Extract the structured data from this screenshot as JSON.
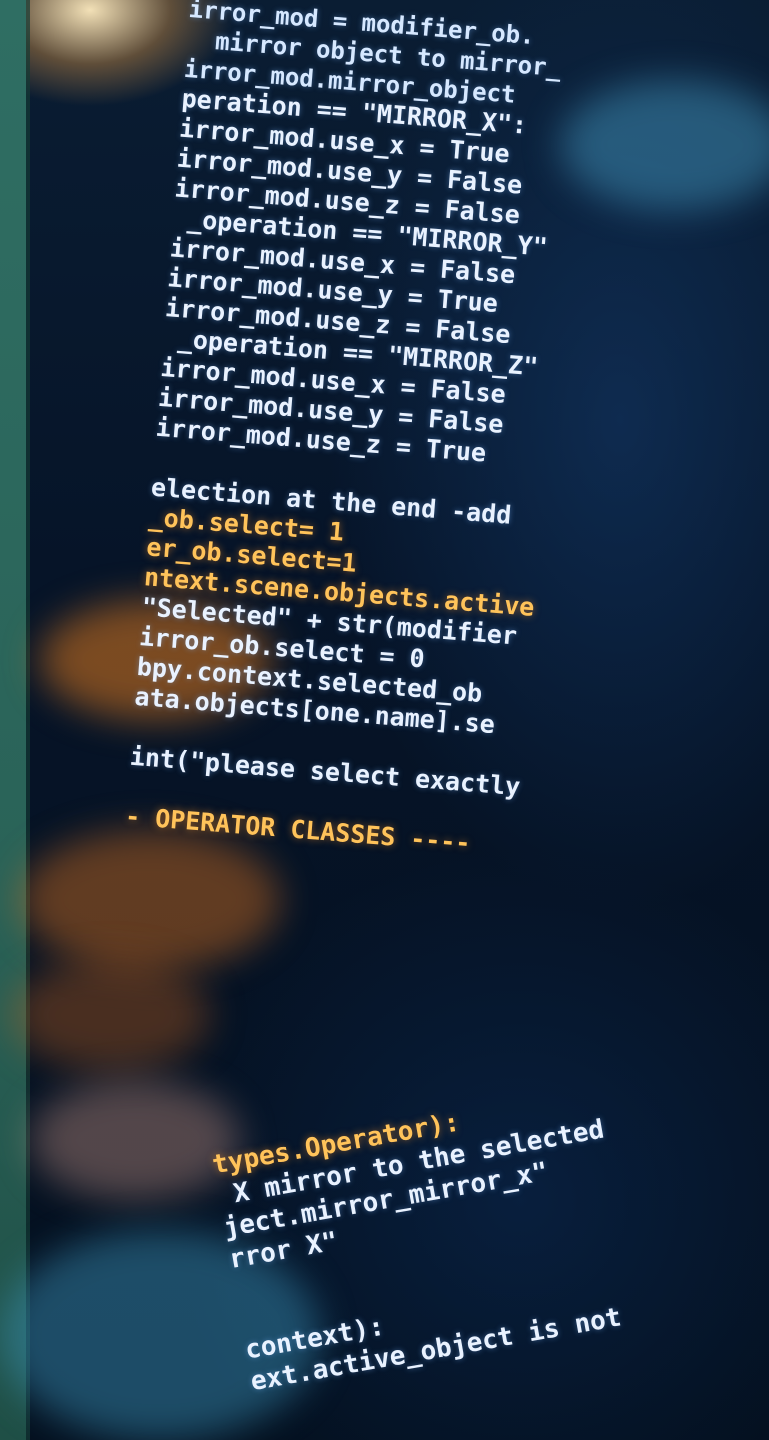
{
  "code_top": [
    "irror_mod = modifier_ob.",
    "  mirror object to mirror_",
    "irror_mod.mirror_object",
    "peration == \"MIRROR_X\":",
    "irror_mod.use_x = True",
    "irror_mod.use_y = False",
    "irror_mod.use_z = False",
    " _operation == \"MIRROR_Y\"",
    "irror_mod.use_x = False",
    "irror_mod.use_y = True",
    "irror_mod.use_z = False",
    " _operation == \"MIRROR_Z\"",
    "irror_mod.use_x = False",
    "irror_mod.use_y = False",
    "irror_mod.use_z = True",
    "",
    "election at the end -add",
    "_ob.select= 1",
    "er_ob.select=1",
    "ntext.scene.objects.active",
    "\"Selected\" + str(modifier",
    "irror_ob.select = 0",
    "bpy.context.selected_ob",
    "ata.objects[one.name].se",
    "",
    "int(\"please select exactly",
    "",
    "- OPERATOR CLASSES ----"
  ],
  "code_bottom": [
    "types.Operator):",
    " X mirror to the selected",
    "ject.mirror_mirror_x\"",
    "rror X\"",
    "",
    "",
    "context):",
    "ext.active_object is not"
  ]
}
